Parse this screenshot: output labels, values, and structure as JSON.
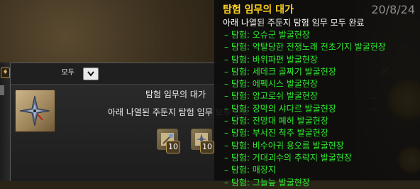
{
  "tooltip": {
    "title": "탐험 임무의 대가",
    "date": "20/8/24",
    "subtitle": "아래 나열된 주둔지 탐험 임무 모두 완료",
    "items": [
      "– 탐험: 오슈군 발굴현장",
      "– 탐험: 약탈당한 전쟁노래 전초기지 발굴현장",
      "– 탐험: 바위파편 발굴현장",
      "– 탐험: 세데크 골짜기 발굴현장",
      "– 탐험: 에펙시스 발굴현장",
      "– 탐험: 앙고로쉬 발굴현장",
      "– 탐험: 장막의 샤다르 발굴현장",
      "– 탐험: 전망대 폐허 발굴현장",
      "– 탐험: 부서진 척추 발굴현장",
      "– 탐험: 비수아귀 용오름 발굴현장",
      "– 탐험: 거대괴수의 추락지 발굴현장",
      "– 탐험: 매장지",
      "– 탐험: 그늘늪 발굴현장"
    ],
    "item_color": "#2fea2f",
    "title_color": "#ffd21e"
  },
  "panel": {
    "filter_label": "모두",
    "filter_icon": "chevron-down-icon",
    "quest_title": "탐험 임무의 대가",
    "quest_desc": "아래 나열된 주둔지 탐험 임무 모두 완료",
    "quest_icon": "map-compass-icon",
    "rewards": [
      {
        "icon": "scroll-reward-icon",
        "count": "10"
      },
      {
        "icon": "compass-reward-icon",
        "count": "10"
      }
    ]
  },
  "background_window": {
    "close_icon": "close-icon"
  }
}
